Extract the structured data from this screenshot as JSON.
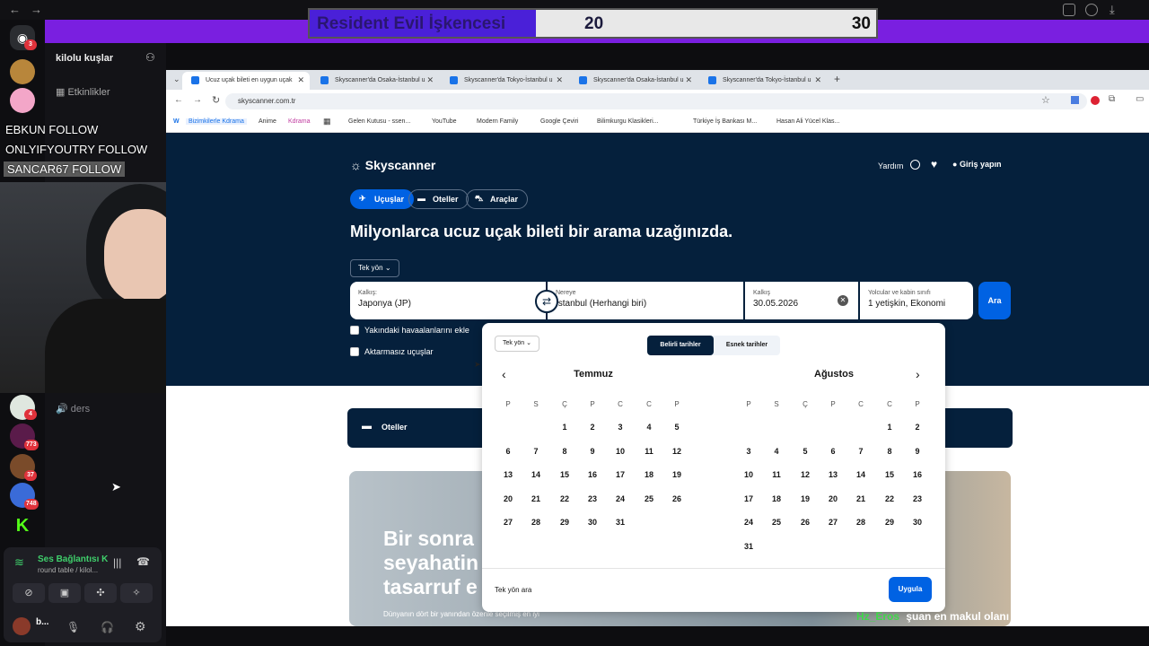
{
  "vote": {
    "title": "Resident Evil İşkencesi",
    "left_value": "20",
    "right_value": "30",
    "left_fraction": 0.4
  },
  "discord": {
    "server_name": "kilolu kuşlar",
    "events_label": "Etkinlikler",
    "channel_ders": "ders",
    "guild_badges": [
      "3",
      "4",
      "773",
      "37",
      "748"
    ],
    "voice_status": "Ses Bağlantısı K",
    "voice_sub": "round table / kilol...",
    "user_name": "b..."
  },
  "follows": [
    "EBKUN FOLLOW",
    "ONLYIFYOUTRY FOLLOW",
    "SANCAR67  FOLLOW"
  ],
  "browser": {
    "tabs": [
      {
        "label": "Ucuz uçak bileti en uygun uçak",
        "active": true
      },
      {
        "label": "Skyscanner'da Osaka-İstanbul u",
        "active": false
      },
      {
        "label": "Skyscanner'da Tokyo-İstanbul u",
        "active": false
      },
      {
        "label": "Skyscanner'da Osaka-İstanbul u",
        "active": false
      },
      {
        "label": "Skyscanner'da Tokyo-İstanbul u",
        "active": false
      }
    ],
    "new_tab": "+",
    "url": "skyscanner.com.tr",
    "bookmarks": [
      "W",
      "Bizimkilerle Kdrama",
      "Anime",
      "Kdrama",
      "Gelen Kutusu - ssen...",
      "YouTube",
      "Modern Family",
      "Google Çeviri",
      "Bilimkurgu Klasikleri...",
      "Türkiye İş Bankası M...",
      "Hasan Ali Yücel Klas..."
    ]
  },
  "sky": {
    "logo": "Skyscanner",
    "help": "Yardım",
    "login": "Giriş yapın",
    "pills": [
      "Uçuşlar",
      "Oteller",
      "Araçlar"
    ],
    "headline": "Milyonlarca ucuz uçak bileti bir arama uzağınızda.",
    "trip_type": "Tek yön",
    "from_label": "Kalkış:",
    "from_value": "Japonya (JP)",
    "to_label": "Nereye",
    "to_value": "İstanbul (Herhangi biri)",
    "depart_label": "Kalkış",
    "depart_value": "30.05.2026",
    "pax_label": "Yolcular ve kabin sınıfı",
    "pax_value": "1 yetişkin, Ekonomi",
    "search": "Ara",
    "nearby": "Yakındaki havaalanlarını ekle",
    "direct": "Aktarmasız uçuşlar",
    "hotels": "Oteller",
    "promo": "Bir sonra seyahatin tasarruf e",
    "promo_sub": "Dünyanın dört bir yanından özenle seçilmiş en iyi"
  },
  "calendar": {
    "trip_select": "Tek yön",
    "tab_fixed": "Belirli tarihler",
    "tab_flex": "Esnek tarihler",
    "weekdays": [
      "P",
      "S",
      "Ç",
      "P",
      "C",
      "C",
      "P"
    ],
    "months": [
      {
        "name": "Temmuz",
        "offset": 2,
        "days": 31
      },
      {
        "name": "Ağustos",
        "offset": 5,
        "days": 31
      }
    ],
    "oneway_search": "Tek yön ara",
    "apply": "Uygula"
  },
  "chat": {
    "user": "Hz_Eros",
    "message": "şuan en makul olanı bu benim gördüğüm",
    "user_color": "#3fd84a"
  }
}
